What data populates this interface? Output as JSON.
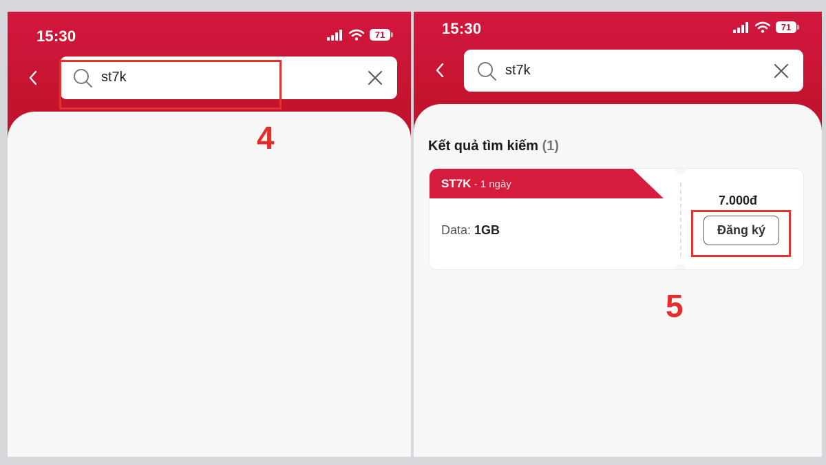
{
  "left_screen": {
    "status": {
      "time": "15:30",
      "battery": "71"
    },
    "search": {
      "value": "st7k"
    },
    "annotation": "4"
  },
  "right_screen": {
    "status": {
      "time": "15:30",
      "battery": "71"
    },
    "search": {
      "value": "st7k"
    },
    "results": {
      "title": "Kết quả tìm kiếm",
      "count": "(1)",
      "items": [
        {
          "code": "ST7K",
          "duration": " - 1 ngày",
          "data_label": "Data:",
          "data_value": "1GB",
          "price": "7.000đ",
          "button_label": "Đăng ký"
        }
      ]
    },
    "annotation": "5"
  },
  "colors": {
    "brand_red": "#c3142f",
    "annotation_red": "#e32f2b",
    "background": "#f7f7f7"
  },
  "icons": [
    "signal-icon",
    "wifi-icon",
    "battery-icon",
    "back-chevron-icon",
    "search-icon",
    "close-icon"
  ]
}
